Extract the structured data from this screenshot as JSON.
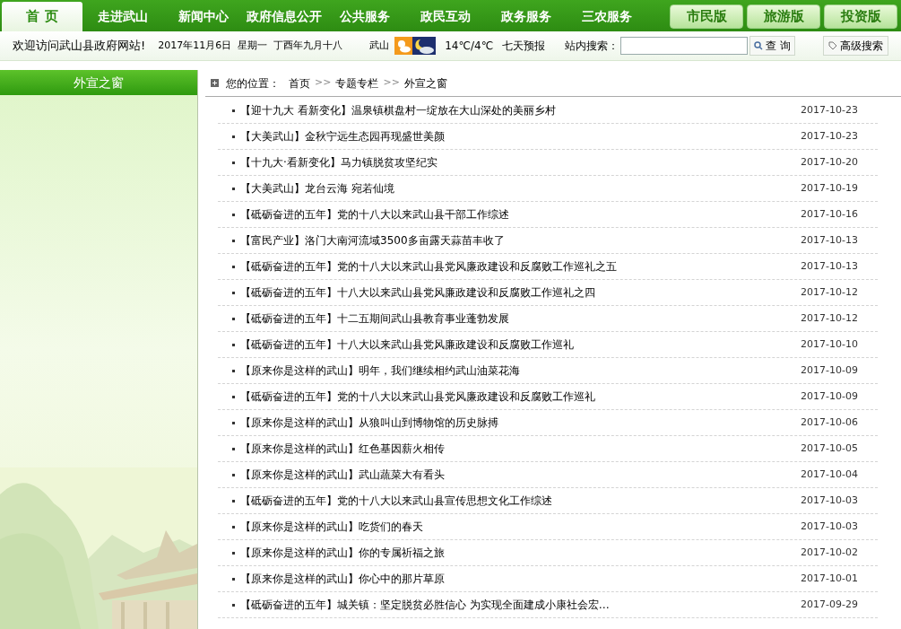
{
  "nav": {
    "tabs": [
      {
        "label": "首 页",
        "selected": true
      },
      {
        "label": "走进武山",
        "selected": false
      },
      {
        "label": "新闻中心",
        "selected": false
      },
      {
        "label": "政府信息公开",
        "selected": false
      },
      {
        "label": "公共服务",
        "selected": false
      },
      {
        "label": "政民互动",
        "selected": false
      },
      {
        "label": "政务服务",
        "selected": false
      },
      {
        "label": "三农服务",
        "selected": false
      }
    ],
    "versions": [
      "市民版",
      "旅游版",
      "投资版"
    ]
  },
  "info_bar": {
    "welcome": "欢迎访问武山县政府网站!",
    "date": "2017年11月6日  星期一  丁酉年九月十八",
    "city": "武山",
    "temperature": "14℃/4℃",
    "forecast_link": "七天预报",
    "search_label": "站内搜索：",
    "search_button": "查 询",
    "advanced_search": "高级搜索"
  },
  "sidebar": {
    "title": "外宣之窗"
  },
  "breadcrumb": {
    "label": "您的位置：",
    "items": [
      "首页",
      "专题专栏",
      "外宣之窗"
    ],
    "separator": ">>"
  },
  "articles": [
    {
      "title": "【迎十九大 看新变化】温泉镇棋盘村一绽放在大山深处的美丽乡村",
      "date": "2017-10-23"
    },
    {
      "title": "【大美武山】金秋宁远生态园再现盛世美颜",
      "date": "2017-10-23"
    },
    {
      "title": "【十九大·看新变化】马力镇脱贫攻坚纪实",
      "date": "2017-10-20"
    },
    {
      "title": "【大美武山】龙台云海 宛若仙境",
      "date": "2017-10-19"
    },
    {
      "title": "【砥砺奋进的五年】党的十八大以来武山县干部工作综述",
      "date": "2017-10-16"
    },
    {
      "title": "【富民产业】洛门大南河流域3500多亩露天蒜苗丰收了",
      "date": "2017-10-13"
    },
    {
      "title": "【砥砺奋进的五年】党的十八大以来武山县党风廉政建设和反腐败工作巡礼之五",
      "date": "2017-10-13"
    },
    {
      "title": "【砥砺奋进的五年】十八大以来武山县党风廉政建设和反腐败工作巡礼之四",
      "date": "2017-10-12"
    },
    {
      "title": "【砥砺奋进的五年】十二五期间武山县教育事业蓬勃发展",
      "date": "2017-10-12"
    },
    {
      "title": "【砥砺奋进的五年】十八大以来武山县党风廉政建设和反腐败工作巡礼",
      "date": "2017-10-10"
    },
    {
      "title": "【原来你是这样的武山】明年，我们继续相约武山油菜花海",
      "date": "2017-10-09"
    },
    {
      "title": "【砥砺奋进的五年】党的十八大以来武山县党风廉政建设和反腐败工作巡礼",
      "date": "2017-10-09"
    },
    {
      "title": "【原来你是这样的武山】从狼叫山到博物馆的历史脉搏",
      "date": "2017-10-06"
    },
    {
      "title": "【原来你是这样的武山】红色基因薪火相传",
      "date": "2017-10-05"
    },
    {
      "title": "【原来你是这样的武山】武山蔬菜大有看头",
      "date": "2017-10-04"
    },
    {
      "title": "【砥砺奋进的五年】党的十八大以来武山县宣传思想文化工作综述",
      "date": "2017-10-03"
    },
    {
      "title": "【原来你是这样的武山】吃货们的春天",
      "date": "2017-10-03"
    },
    {
      "title": "【原来你是这样的武山】你的专属祈福之旅",
      "date": "2017-10-02"
    },
    {
      "title": "【原来你是这样的武山】你心中的那片草原",
      "date": "2017-10-01"
    },
    {
      "title": "【砥砺奋进的五年】城关镇：坚定脱贫必胜信心 为实现全面建成小康社会宏…",
      "date": "2017-09-29"
    }
  ]
}
